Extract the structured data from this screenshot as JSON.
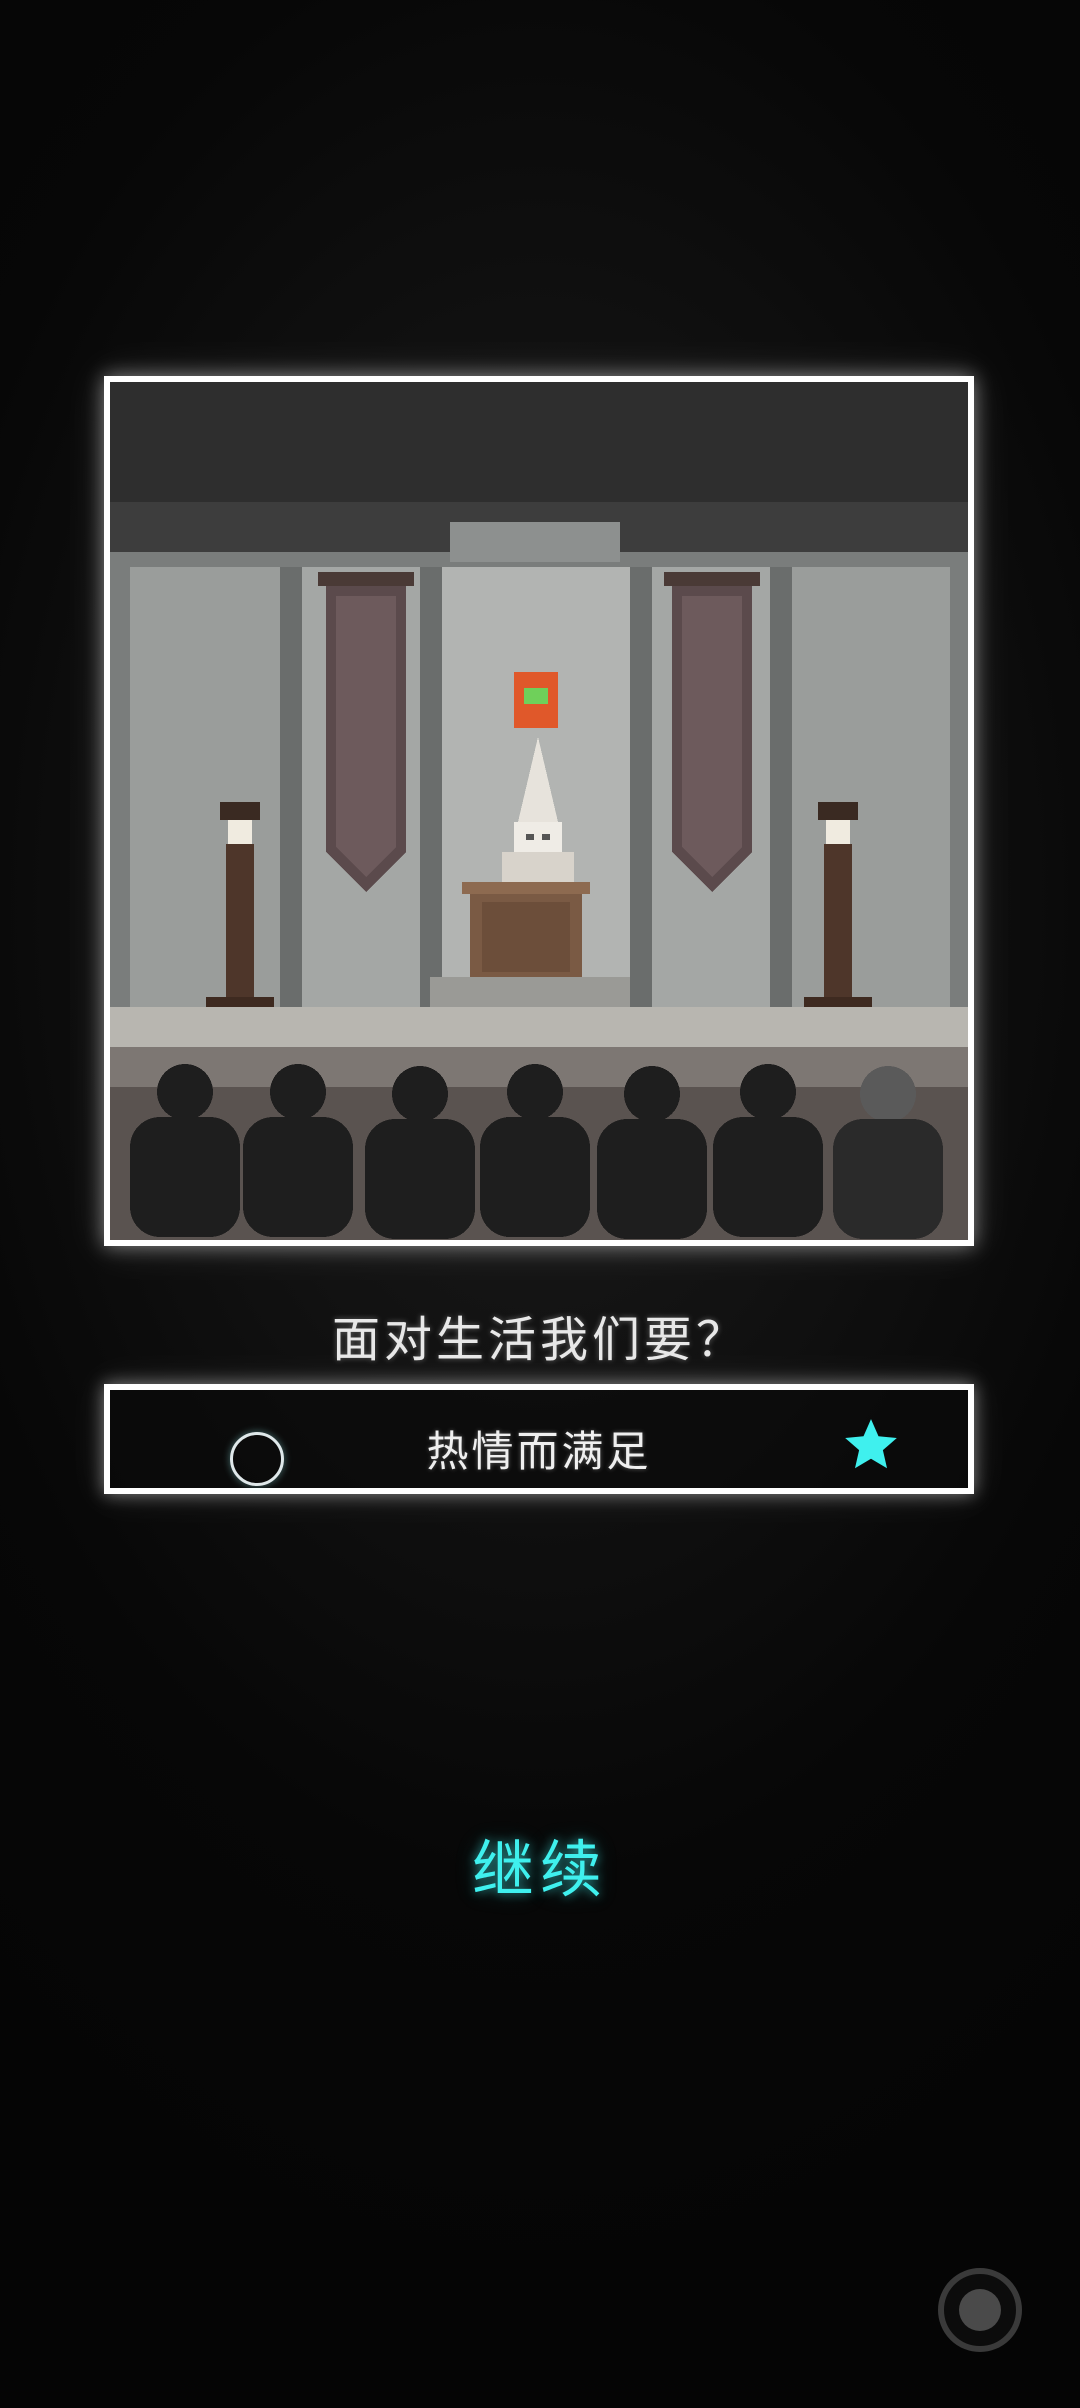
{
  "scene": {
    "image": "pixel-art-lecture-hall",
    "description_icons": [
      "banner-left-icon",
      "banner-right-icon",
      "lamp-left-icon",
      "lamp-right-icon",
      "speaker-figure-icon",
      "podium-icon",
      "audience-icon",
      "sign-icon"
    ]
  },
  "question": {
    "text": "面对生活我们要？"
  },
  "answer": {
    "text": "热情而满足",
    "marker_icon": "circle-icon",
    "reward_icon": "star-icon"
  },
  "continue_button": {
    "label": "继续"
  },
  "record_button": {
    "icon": "record-icon"
  },
  "colors": {
    "accent": "#3ff0ee",
    "frame": "#ffffff",
    "background": "#0a0a0a"
  }
}
